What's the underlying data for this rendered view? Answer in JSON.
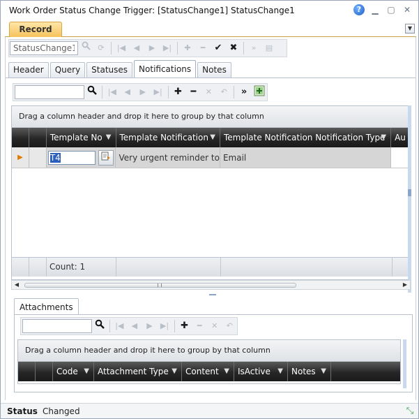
{
  "window": {
    "title": "Work Order Status Change Trigger: [StatusChange1] StatusChange1",
    "controls": {
      "help": "?",
      "minimize": "▁",
      "maximize": "▢",
      "close": "✕"
    }
  },
  "record_tab": {
    "label": "Record",
    "dropdown": "▼"
  },
  "record_toolbar": {
    "input_value": "StatusChange1",
    "icons": [
      "search-icon",
      "refresh-icon",
      "first-icon",
      "prev-icon",
      "next-icon",
      "last-icon",
      "add-icon",
      "remove-icon",
      "accept-icon",
      "cancel-icon",
      "more-icon",
      "notes-icon"
    ]
  },
  "tabs": [
    {
      "label": "Header"
    },
    {
      "label": "Query"
    },
    {
      "label": "Statuses"
    },
    {
      "label": "Notifications",
      "active": true
    },
    {
      "label": "Notes"
    }
  ],
  "notifications": {
    "search_value": "",
    "group_text": "Drag a column header and drop it here to group by that column",
    "columns": [
      "Template No",
      "Template Notification",
      "Template Notification Notification Type",
      "Au"
    ],
    "rows": [
      {
        "template_no": "T4",
        "template_notification": "Very urgent reminder to C",
        "type": "Email",
        "au": ""
      }
    ],
    "footer": "Count: 1"
  },
  "attachments": {
    "tab_label": "Attachments",
    "search_value": "",
    "group_text": "Drag a column header and drop it here to group by that column",
    "columns": [
      "Code",
      "Attachment Type",
      "Content",
      "IsActive",
      "Notes"
    ]
  },
  "status": {
    "label": "Status",
    "value": "Changed"
  },
  "colors": {
    "accent": "#f6c35c",
    "header_dark": "#262626",
    "row_bg": "#d6d6d6"
  }
}
